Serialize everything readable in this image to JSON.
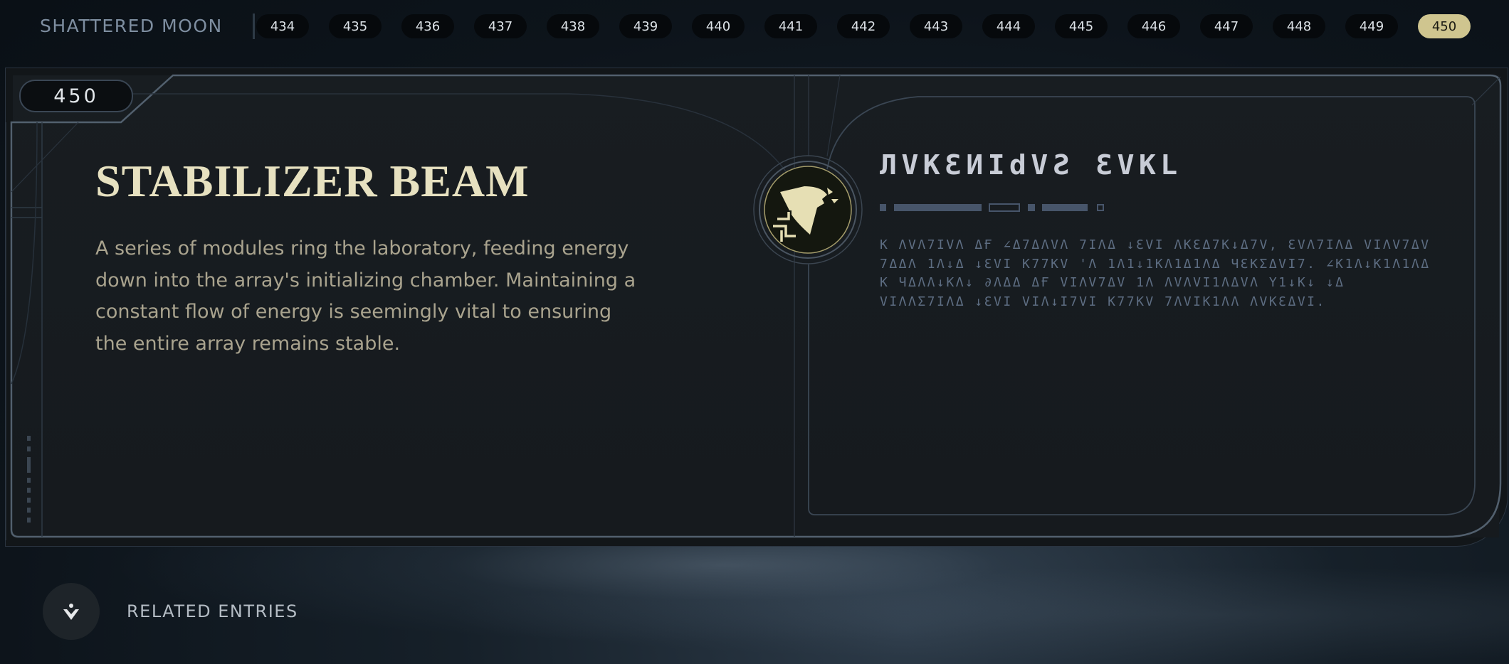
{
  "header": {
    "area_name": "SHATTERED MOON",
    "tabs": [
      "434",
      "435",
      "436",
      "437",
      "438",
      "439",
      "440",
      "441",
      "442",
      "443",
      "444",
      "445",
      "446",
      "447",
      "448",
      "449",
      "450"
    ],
    "active_tab": "450"
  },
  "entry": {
    "number": "450",
    "title": "STABILIZER BEAM",
    "description": "A series of modules ring the laboratory, feeding energy down into the array's initializing chamber. Maintaining a constant flow of energy is seemingly vital to ensuring the entire array remains stable.",
    "emblem_icon": "force-crest-icon",
    "aurebesh_title": "ЛVKƐИIdVƧ ƐVKL",
    "aurebesh_body": "K ΛVΛ7IVΛ ΔҒ ∠Δ7ΔΛVΛ 7IΛΔ ↓ƐVI ΛKƐΔ7K↓Δ7V, ƐVΛ7IΛΔ VIΛV7ΔV 7ΔΔΛ 1Λ↓Δ ↓ƐVI K77KV 'Λ 1Λ1↓1KΛ1Δ1ΛΔ ЧƐKΣΔVI7. ∠K1Λ↓K1Λ1ΛΔ K ЧΔΛΛ↓KΛ↓ ∂ΛΔΔ ΔҒ VIΛV7ΔV 1Λ ΛVΛVI1ΛΔVΛ Y1↓K↓ ↓Δ VIΛΛΣ7IΛΔ ↓ƐVI VIΛ↓I7VI K77KV 7ΛVIK1ΛΛ ΛVKƐΔVI."
  },
  "footer": {
    "related_label": "RELATED ENTRIES",
    "related_icon": "crest-small-icon"
  },
  "colors": {
    "accent": "#cfc58f",
    "title": "#e7e1c0",
    "body_text": "#a9a38e",
    "aurebesh": "#5d6d82",
    "frame": "#52606e"
  }
}
